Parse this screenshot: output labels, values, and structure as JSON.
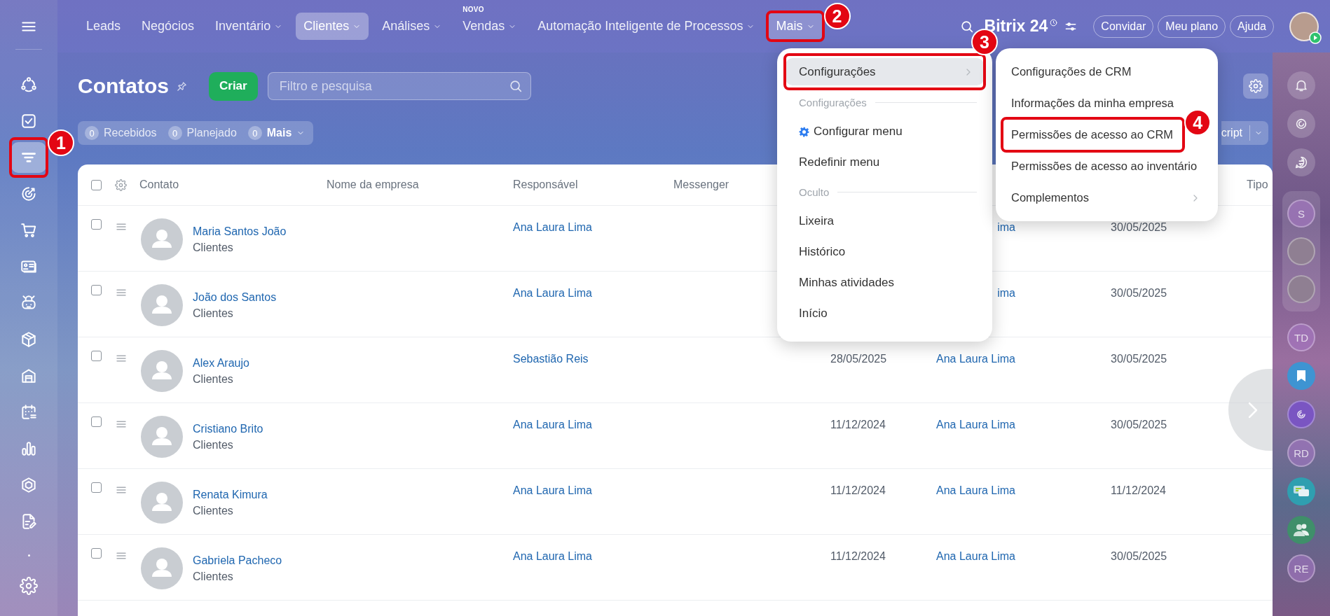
{
  "top_nav": {
    "items": [
      {
        "label": "Leads",
        "dropdown": false,
        "selected": false,
        "open": false
      },
      {
        "label": "Negócios",
        "dropdown": false,
        "selected": false,
        "open": false
      },
      {
        "label": "Inventário",
        "dropdown": true,
        "selected": false,
        "open": false
      },
      {
        "label": "Clientes",
        "dropdown": true,
        "selected": true,
        "open": false
      },
      {
        "label": "Análises",
        "dropdown": true,
        "selected": false,
        "open": false
      },
      {
        "label": "Vendas",
        "dropdown": true,
        "selected": false,
        "open": false,
        "badge": "NOVO"
      },
      {
        "label": "Automação Inteligente de Processos",
        "dropdown": true,
        "selected": false,
        "open": false
      },
      {
        "label": "Mais",
        "dropdown": true,
        "selected": false,
        "open": true,
        "callout": "2"
      }
    ],
    "logo": "Bitrix 24",
    "buttons": [
      "Convidar",
      "Meu plano",
      "Ajuda"
    ]
  },
  "left_sidebar": {
    "items": [
      {
        "kind": "flow",
        "selected": false
      },
      {
        "kind": "tasks",
        "selected": false
      },
      {
        "kind": "funnel",
        "selected": true,
        "callout": "1"
      },
      {
        "kind": "target",
        "selected": false
      },
      {
        "kind": "cart",
        "selected": false
      },
      {
        "kind": "card",
        "selected": false
      },
      {
        "kind": "robot",
        "selected": false
      },
      {
        "kind": "box",
        "selected": false
      },
      {
        "kind": "warehouse",
        "selected": false
      },
      {
        "kind": "calendar",
        "selected": false
      },
      {
        "kind": "chart",
        "selected": false
      },
      {
        "kind": "hexagon",
        "selected": false
      },
      {
        "kind": "document",
        "selected": false
      },
      {
        "kind": "dot",
        "selected": false
      },
      {
        "kind": "settings",
        "selected": false
      }
    ]
  },
  "page": {
    "title": "Contatos",
    "create_button": "Criar",
    "search": {
      "placeholder": "Filtro e pesquisa"
    },
    "counters": [
      {
        "kind": "counter",
        "count": "0",
        "label": "Recebidos"
      },
      {
        "kind": "counter",
        "count": "0",
        "label": "Planejado"
      },
      {
        "kind": "dropdown",
        "count": "0",
        "label": "Mais"
      }
    ],
    "script_button": "cript"
  },
  "table": {
    "select_all_checked": false,
    "columns": [
      "Contato",
      "Nome da empresa",
      "Responsável",
      "Messenger"
    ],
    "last_column": "Tipo",
    "rows": [
      {
        "checked": false,
        "name": "Maria Santos João",
        "type": "Clientes",
        "responsible": "Ana Laura Lima",
        "column_6": "ima",
        "column_7": "30/05/2025"
      },
      {
        "checked": false,
        "name": "João dos Santos",
        "type": "Clientes",
        "responsible": "Ana Laura Lima",
        "column_6": "ima",
        "column_7": "30/05/2025"
      },
      {
        "checked": false,
        "name": "Alex Araujo",
        "type": "Clientes",
        "responsible": "Sebastião Reis",
        "column_5": "28/05/2025",
        "column_6": "Ana Laura Lima",
        "column_7": "30/05/2025"
      },
      {
        "checked": false,
        "name": "Cristiano Brito",
        "type": "Clientes",
        "responsible": "Ana Laura Lima",
        "column_5": "11/12/2024",
        "column_6": "Ana Laura Lima",
        "column_7": "30/05/2025"
      },
      {
        "checked": false,
        "name": "Renata Kimura",
        "type": "Clientes",
        "responsible": "Ana Laura Lima",
        "column_5": "11/12/2024",
        "column_6": "Ana Laura Lima",
        "column_7": "11/12/2024"
      },
      {
        "checked": false,
        "name": "Gabriela Pacheco",
        "type": "Clientes",
        "responsible": "Ana Laura Lima",
        "column_5": "11/12/2024",
        "column_6": "Ana Laura Lima",
        "column_7": "30/05/2025"
      }
    ]
  },
  "more_menu": {
    "items": [
      {
        "kind": "item",
        "label": "Configurações",
        "submenu": true,
        "selected": true,
        "callout": "3"
      },
      {
        "kind": "section",
        "label": "Configurações"
      },
      {
        "kind": "gear-item",
        "label": "Configurar menu",
        "submenu": false,
        "selected": false
      },
      {
        "kind": "item",
        "label": "Redefinir menu",
        "submenu": false,
        "selected": false
      },
      {
        "kind": "section",
        "label": "Oculto"
      },
      {
        "kind": "item",
        "label": "Lixeira",
        "submenu": false,
        "selected": false
      },
      {
        "kind": "item",
        "label": "Histórico",
        "submenu": false,
        "selected": false
      },
      {
        "kind": "item",
        "label": "Minhas atividades",
        "submenu": false,
        "selected": false
      },
      {
        "kind": "item",
        "label": "Início",
        "submenu": false,
        "selected": false
      }
    ]
  },
  "settings_submenu": {
    "items": [
      {
        "label": "Configurações de CRM",
        "submenu": false,
        "selected": false
      },
      {
        "label": "Informações da minha empresa",
        "submenu": false,
        "selected": false
      },
      {
        "label": "Permissões de acesso ao CRM",
        "submenu": false,
        "selected": false,
        "callout": "4"
      },
      {
        "label": "Permissões de acesso ao inventário",
        "submenu": false,
        "selected": false
      },
      {
        "label": "Complementos",
        "submenu": true,
        "selected": false
      }
    ]
  },
  "right_sidebar": {
    "top": [
      {
        "kind": "bell"
      },
      {
        "kind": "swirl"
      },
      {
        "kind": "chat-swap"
      }
    ],
    "recent": [
      {
        "kind": "letter",
        "text": "S"
      },
      {
        "kind": "photo"
      },
      {
        "kind": "photo"
      }
    ],
    "bottom": [
      {
        "kind": "letter",
        "text": "TD"
      },
      {
        "kind": "bookmark"
      },
      {
        "kind": "swirl-color"
      },
      {
        "kind": "letter",
        "text": "RD"
      },
      {
        "kind": "chat-color"
      },
      {
        "kind": "people"
      },
      {
        "kind": "letter",
        "text": "RE"
      }
    ]
  }
}
